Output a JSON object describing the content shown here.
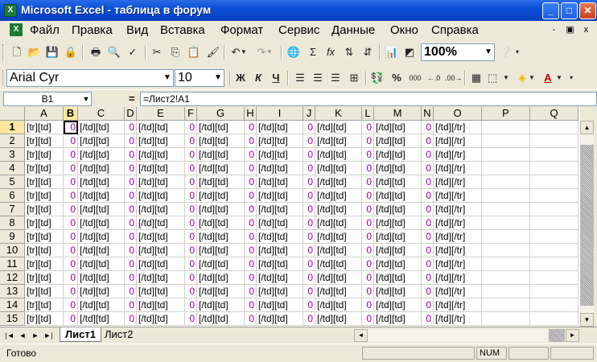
{
  "window": {
    "title": "Microsoft Excel - таблица в форум",
    "minimize": "_",
    "maximize": "□",
    "close": "✕"
  },
  "menubar": {
    "items": [
      "Файл",
      "Правка",
      "Вид",
      "Вставка",
      "Формат",
      "Сервис",
      "Данные",
      "Окно",
      "Справка"
    ],
    "doc_min": "-",
    "doc_restore": "▣",
    "doc_close": "x"
  },
  "toolbar": {
    "zoom": "100%",
    "font": "Arial Cyr",
    "size": "10",
    "bold": "Ж",
    "italic": "К",
    "underline": "Ч",
    "percent": "%",
    "thousands": "000",
    "autosum": "Σ",
    "fx": "fx"
  },
  "formula_bar": {
    "cell_ref": "B1",
    "eq": "=",
    "formula": "=Лист2!A1"
  },
  "grid": {
    "columns": [
      "A",
      "B",
      "C",
      "D",
      "E",
      "F",
      "G",
      "H",
      "I",
      "J",
      "K",
      "L",
      "M",
      "N",
      "O",
      "P",
      "Q"
    ],
    "selected_column": "B",
    "selected_row": "1",
    "rows": [
      "1",
      "2",
      "3",
      "4",
      "5",
      "6",
      "7",
      "8",
      "9",
      "10",
      "11",
      "12",
      "13",
      "14",
      "15"
    ],
    "row_template": [
      "[tr][td]",
      "0",
      "[/td][td]",
      "0",
      "[/td][td]",
      "0",
      "[/td][td]",
      "0",
      "[/td][td]",
      "0",
      "[/td][td]",
      "0",
      "[/td][td]",
      "0",
      "[/td][/tr]",
      "",
      ""
    ]
  },
  "sheets": {
    "tabs": [
      "Лист1",
      "Лист2"
    ],
    "active": "Лист1",
    "nav": [
      "|◄",
      "◄",
      "►",
      "►|"
    ]
  },
  "status": {
    "text": "Готово",
    "num": "NUM"
  },
  "colors": {
    "title_bar": "#0A4FD8",
    "number_text": "#A100A1",
    "header_selected": "#FFE7A0"
  }
}
